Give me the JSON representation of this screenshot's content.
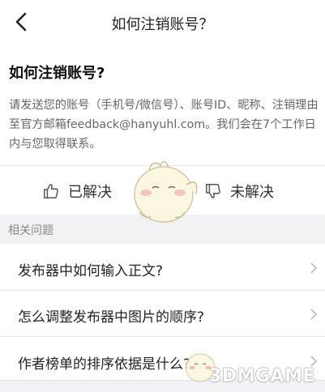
{
  "header": {
    "title": "如何注销账号？",
    "back_icon": "back-arrow-icon"
  },
  "question": {
    "title": "如何注销账号?",
    "body": "请发送您的账号（手机号/微信号）、账号ID、昵称、注销理由至官方邮箱feedback@hanyuhl.com。我们会在7个工作日内与您取得联系。"
  },
  "feedback": {
    "solved_label": "已解决",
    "solved_icon": "thumbs-up-icon",
    "unsolved_label": "未解决",
    "unsolved_icon": "thumbs-down-icon"
  },
  "related": {
    "heading": "相关问题",
    "items": [
      {
        "label": "发布器中如何输入正文?"
      },
      {
        "label": "怎么调整发布器中图片的顺序?"
      },
      {
        "label": "作者榜单的排序依据是什么?"
      }
    ]
  },
  "watermark": {
    "text": "3DMGAME"
  },
  "colors": {
    "text": "#222222",
    "secondary": "#666666",
    "divider": "#e8e8e8",
    "section_bg": "#f2f2f4"
  }
}
